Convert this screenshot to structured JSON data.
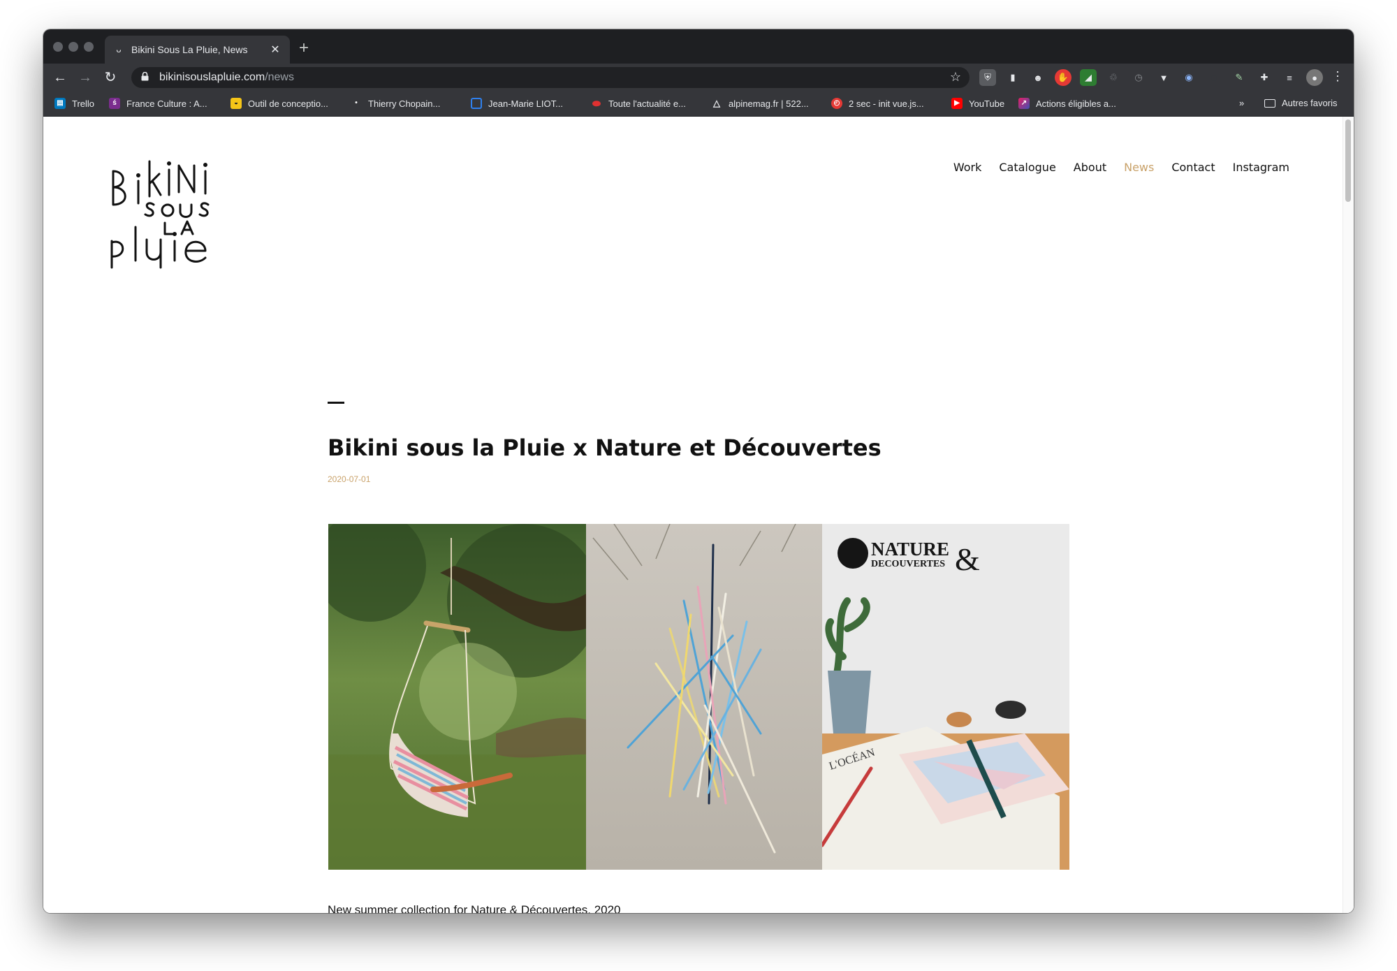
{
  "browser": {
    "tab": {
      "title": "Bikini Sous La Pluie, News",
      "favicon": "bikini-icon",
      "close_label": "✕"
    },
    "new_tab_label": "+",
    "address": {
      "host": "bikinisouslapluie.com",
      "path": "/news"
    },
    "bookmarks": [
      {
        "label": "Trello",
        "icon": "trello-icon",
        "color": "#0079bf"
      },
      {
        "label": "France Culture : A...",
        "icon": "france-culture-icon",
        "color": "#7b2d8e"
      },
      {
        "label": "Outil de conceptio...",
        "icon": "design-tool-icon",
        "color": "#f5c518"
      },
      {
        "label": "Thierry Chopain...",
        "icon": "dot-icon",
        "color": "#35363a"
      },
      {
        "label": "Jean-Marie LIOT...",
        "icon": "square-outline-icon",
        "color": "#2f80ed"
      },
      {
        "label": "Toute l'actualité e...",
        "icon": "lips-icon",
        "color": "#e03131"
      },
      {
        "label": "alpinemag.fr | 522...",
        "icon": "mountain-icon",
        "color": "#35363a"
      },
      {
        "label": "2 sec - init vue.js...",
        "icon": "timer-icon",
        "color": "#e53935"
      },
      {
        "label": "YouTube",
        "icon": "youtube-icon",
        "color": "#ff0000"
      },
      {
        "label": "Actions éligibles a...",
        "icon": "arrow-logo-icon",
        "color": "#6c3be0"
      }
    ],
    "overflow_label": "»",
    "other_bookmarks_label": "Autres favoris"
  },
  "site": {
    "logo_lines": [
      "Bikini",
      "sous",
      "la",
      "pluie"
    ],
    "nav": [
      {
        "label": "Work",
        "active": false
      },
      {
        "label": "Catalogue",
        "active": false
      },
      {
        "label": "About",
        "active": false
      },
      {
        "label": "News",
        "active": true
      },
      {
        "label": "Contact",
        "active": false
      },
      {
        "label": "Instagram",
        "active": false
      }
    ],
    "accent_color": "#c9a26a"
  },
  "post": {
    "title": "Bikini sous la Pluie x Nature et Découvertes",
    "date": "2020-07-01",
    "collage": {
      "brand_line1": "NATURE",
      "brand_amp": "&",
      "brand_line2": "DECOUVERTES",
      "notebook_label": "L'OCÉAN"
    },
    "excerpt": "New summer collection for Nature & Découvertes, 2020"
  }
}
